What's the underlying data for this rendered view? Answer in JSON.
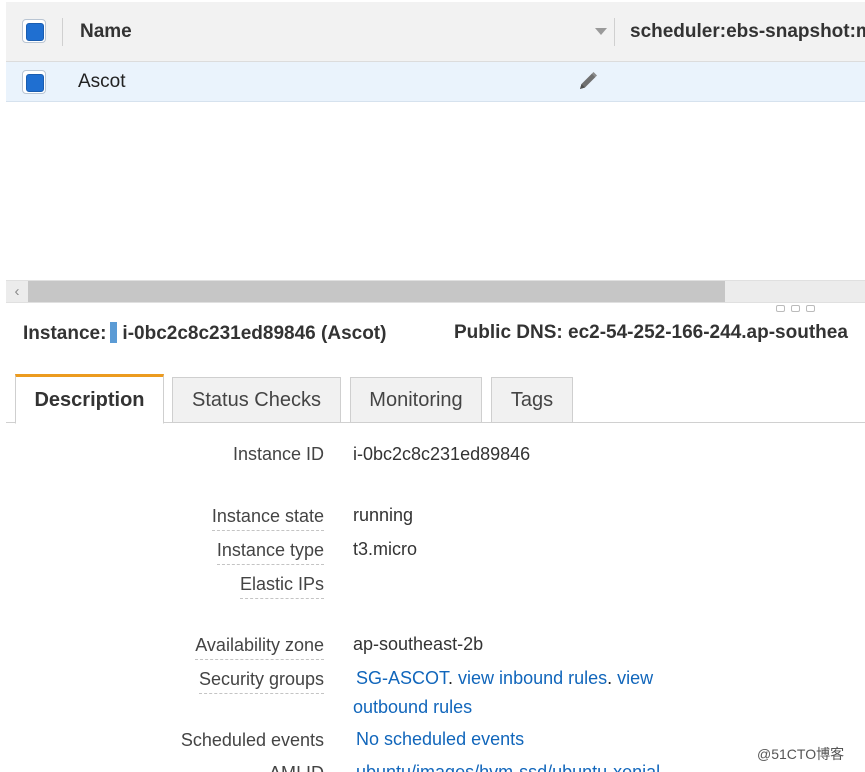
{
  "table": {
    "columns": {
      "name": "Name",
      "tag": "scheduler:ebs-snapshot:m"
    },
    "rows": [
      {
        "name": "Ascot"
      }
    ]
  },
  "summary": {
    "instance_label": "Instance:",
    "instance_value": "i-0bc2c8c231ed89846 (Ascot)",
    "dns_label": "Public DNS:",
    "dns_value": "ec2-54-252-166-244.ap-southea"
  },
  "tabs": [
    {
      "label": "Description"
    },
    {
      "label": "Status Checks"
    },
    {
      "label": "Monitoring"
    },
    {
      "label": "Tags"
    }
  ],
  "details": {
    "instance_id": {
      "label": "Instance ID",
      "value": "i-0bc2c8c231ed89846"
    },
    "instance_state": {
      "label": "Instance state",
      "value": "running"
    },
    "instance_type": {
      "label": "Instance type",
      "value": "t3.micro"
    },
    "elastic_ips": {
      "label": "Elastic IPs",
      "value": ""
    },
    "availability_zone": {
      "label": "Availability zone",
      "value": "ap-southeast-2b"
    },
    "security_groups": {
      "label": "Security groups",
      "group_link": "SG-ASCOT",
      "sep": ".",
      "inbound_link": "view inbound rules",
      "outbound_link_1": "view",
      "outbound_link_2": "outbound rules"
    },
    "scheduled_events": {
      "label": "Scheduled events",
      "value": "No scheduled events"
    },
    "ami_id": {
      "label": "AMI ID",
      "value": "ubuntu/images/hvm-ssd/ubuntu-xenial"
    }
  },
  "watermark": "@51CTO博客",
  "colors": {
    "selection": "#1f6fd1",
    "row_highlight": "#eaf3fc",
    "active_tab": "#ec9b1f",
    "link": "#1166bb"
  }
}
